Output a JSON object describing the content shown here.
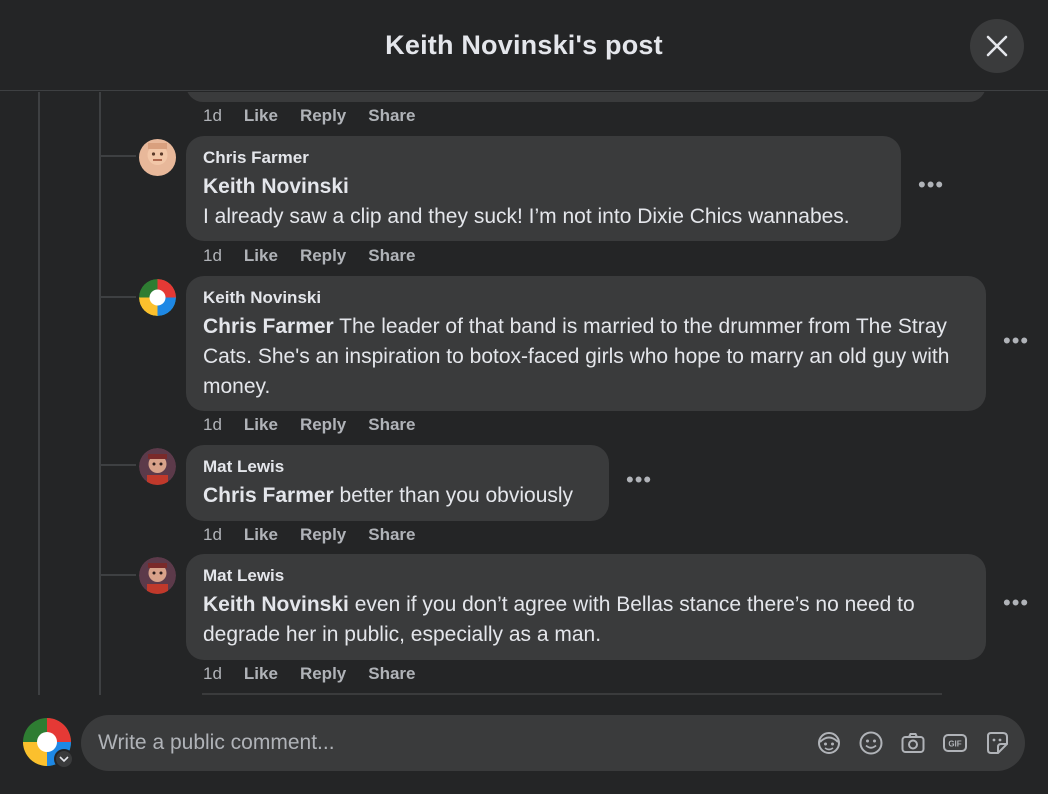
{
  "header": {
    "title": "Keith Novinski's post"
  },
  "actions": {
    "time": "1d",
    "like": "Like",
    "reply": "Reply",
    "share": "Share"
  },
  "comments": [
    {
      "author": "Chris Farmer",
      "mention": "Keith Novinski",
      "text": "I already saw a clip and they suck! I’m not into Dixie Chics wannabes."
    },
    {
      "author": "Keith Novinski",
      "mention": "Chris Farmer",
      "text": " The leader of that band is married to the drummer from The Stray Cats. She's an inspiration to botox-faced girls who hope to marry an old guy with money."
    },
    {
      "author": "Mat Lewis",
      "mention": "Chris Farmer",
      "text": " better than you obviously"
    },
    {
      "author": "Mat Lewis",
      "mention": "Keith Novinski",
      "text": " even if you don’t agree with Bellas stance there’s no need to degrade her in public, especially as a man."
    }
  ],
  "composer": {
    "placeholder": "Write a public comment..."
  },
  "icons": [
    "close-icon",
    "more-icon",
    "avatar-sticker-icon",
    "emoji-icon",
    "camera-icon",
    "gif-icon",
    "sticker-icon",
    "chevron-down-icon"
  ],
  "colors": {
    "background": "#242526",
    "bubble": "#3a3b3c",
    "text": "#e4e6eb",
    "secondary": "#b0b3b8"
  }
}
